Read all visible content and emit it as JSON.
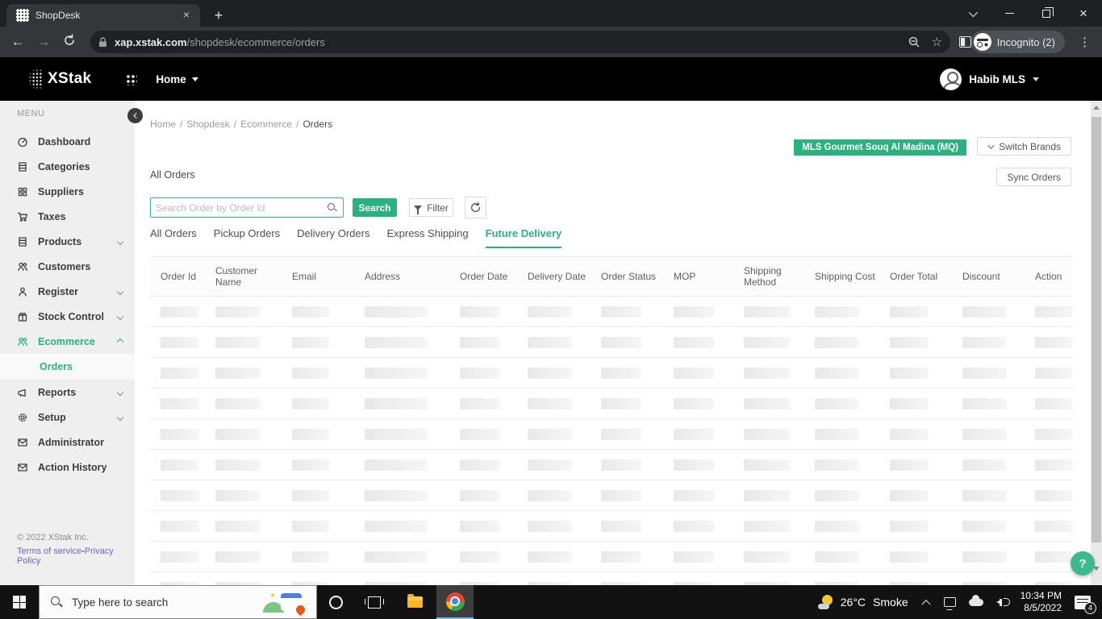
{
  "browser": {
    "tab_title": "ShopDesk",
    "new_tab_button": "+",
    "url_host": "xap.xstak.com",
    "url_path": "/shopdesk/ecommerce/orders",
    "incognito_label": "Incognito (2)",
    "menu_dots": "⋮",
    "back": "←",
    "forward": "→",
    "star": "☆"
  },
  "app_header": {
    "logo_text": "XStak",
    "nav_item": "Home",
    "user_name": "Habib MLS"
  },
  "sidebar": {
    "menu_label": "MENU",
    "items": [
      {
        "label": "Dashboard",
        "icon": "dashboard-icon"
      },
      {
        "label": "Categories",
        "icon": "categories-icon"
      },
      {
        "label": "Suppliers",
        "icon": "suppliers-icon"
      },
      {
        "label": "Taxes",
        "icon": "taxes-icon"
      },
      {
        "label": "Products",
        "icon": "products-icon",
        "expandable": true
      },
      {
        "label": "Customers",
        "icon": "customers-icon"
      },
      {
        "label": "Register",
        "icon": "register-icon",
        "expandable": true
      },
      {
        "label": "Stock Control",
        "icon": "stock-control-icon",
        "expandable": true
      },
      {
        "label": "Ecommerce",
        "icon": "ecommerce-icon",
        "expandable": true,
        "expanded": true,
        "active": true
      },
      {
        "label": "Reports",
        "icon": "reports-icon",
        "expandable": true
      },
      {
        "label": "Setup",
        "icon": "setup-icon",
        "expandable": true
      },
      {
        "label": "Administrator",
        "icon": "administrator-icon"
      },
      {
        "label": "Action History",
        "icon": "action-history-icon"
      }
    ],
    "active_sub_item": "Orders",
    "copyright": "© 2022 XStak Inc.",
    "terms_link": "Terms of service",
    "links_separator": "-",
    "privacy_link": "Privacy Policy"
  },
  "main": {
    "breadcrumb": {
      "items": [
        "Home",
        "Shopdesk",
        "Ecommerce"
      ],
      "separator": "/",
      "current": "Orders"
    },
    "brand_badge": "MLS Gourmet Souq Al Madina (MQ)",
    "switch_brands_button": "Switch Brands",
    "sync_orders_button": "Sync Orders",
    "page_title": "All Orders",
    "search": {
      "placeholder": "Search Order by Order Id",
      "value": "",
      "button": "Search"
    },
    "filter_button": "Filter",
    "tabs": [
      "All Orders",
      "Pickup Orders",
      "Delivery Orders",
      "Express Shipping",
      "Future Delivery"
    ],
    "active_tab": "Future Delivery",
    "table": {
      "columns": [
        "Order Id",
        "Customer Name",
        "Email",
        "Address",
        "Order Date",
        "Delivery Date",
        "Order Status",
        "MOP",
        "Shipping Method",
        "Shipping Cost",
        "Order Total",
        "Discount",
        "Action"
      ],
      "state": "loading",
      "loading_rows": 10
    },
    "help_button": "?"
  },
  "taskbar": {
    "search_placeholder": "Type here to search",
    "weather_temp": "26°C",
    "weather_condition": "Smoke",
    "clock_time": "10:34 PM",
    "clock_date": "8/5/2022",
    "notification_count": "4"
  },
  "colors": {
    "accent_green": "#29b180",
    "badge_green": "#29b180",
    "help_green": "#3dba8c",
    "link_blue": "#5f6ccb",
    "taskbar_active_underline": "#76b9ed"
  }
}
